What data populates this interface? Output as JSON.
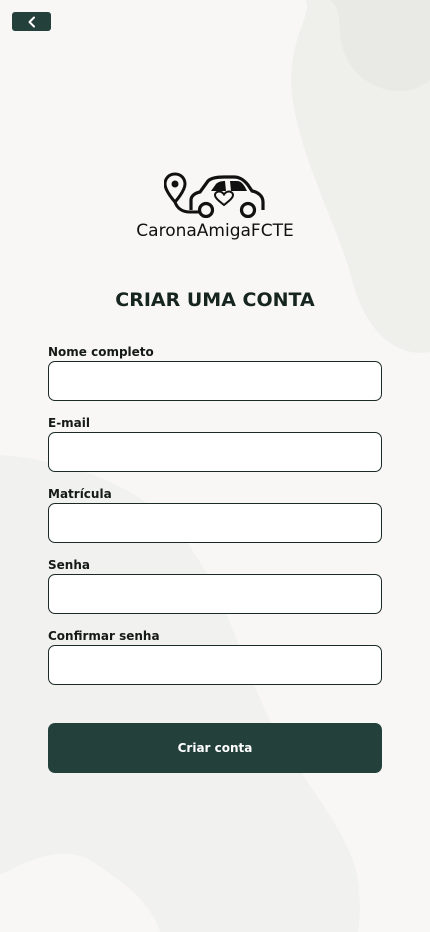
{
  "colors": {
    "primary": "#24403b",
    "background": "#f8f7f5",
    "blob": "#efefec"
  },
  "header": {
    "back_icon": "chevron-left-icon"
  },
  "logo": {
    "icon": "car-location-pin-icon",
    "text": "CaronaAmigaFCTE"
  },
  "page": {
    "title": "CRIAR UMA CONTA"
  },
  "form": {
    "fields": [
      {
        "label": "Nome completo",
        "value": "",
        "placeholder": ""
      },
      {
        "label": "E-mail",
        "value": "",
        "placeholder": ""
      },
      {
        "label": "Matrícula",
        "value": "",
        "placeholder": ""
      },
      {
        "label": "Senha",
        "value": "",
        "placeholder": ""
      },
      {
        "label": "Confirmar senha",
        "value": "",
        "placeholder": ""
      }
    ],
    "submit_label": "Criar conta"
  }
}
